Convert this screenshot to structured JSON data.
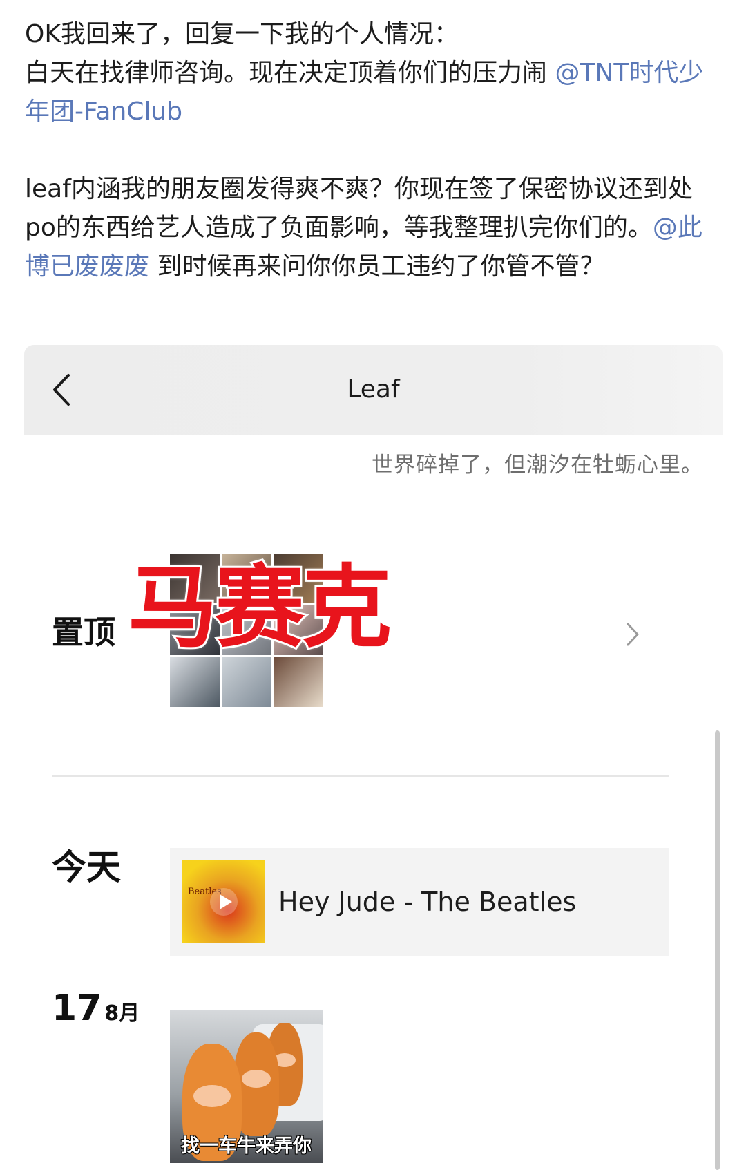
{
  "post": {
    "line1": "OK我回来了，回复一下我的个人情况：",
    "line2_text": "白天在找律师咨询。现在决定顶着你们的压力闹 ",
    "mention1": "@TNT时代少年团-FanClub",
    "para2_text": "leaf内涵我的朋友圈发得爽不爽？你现在签了保密协议还到处po的东西给艺人造成了负面影响，等我整理扒完你们的。",
    "mention2": "@此博已废废废",
    "para2_tail": " 到时候再来问你你员工违约了你管不管？"
  },
  "screenshot": {
    "nav": {
      "title": "Leaf",
      "back_icon": "chevron-left-icon"
    },
    "signature": "世界碎掉了，但潮汐在牡蛎心里。",
    "pinned": {
      "label": "置顶",
      "censor_text": "马赛克",
      "chevron_icon": "chevron-right-icon"
    },
    "today": {
      "label": "今天",
      "music_title": "Hey Jude - The Beatles",
      "cover_text": "Beatles",
      "play_icon": "play-icon"
    },
    "entry2": {
      "day": "17",
      "month": "8月",
      "meme_caption": "找一车牛来弄你"
    }
  }
}
